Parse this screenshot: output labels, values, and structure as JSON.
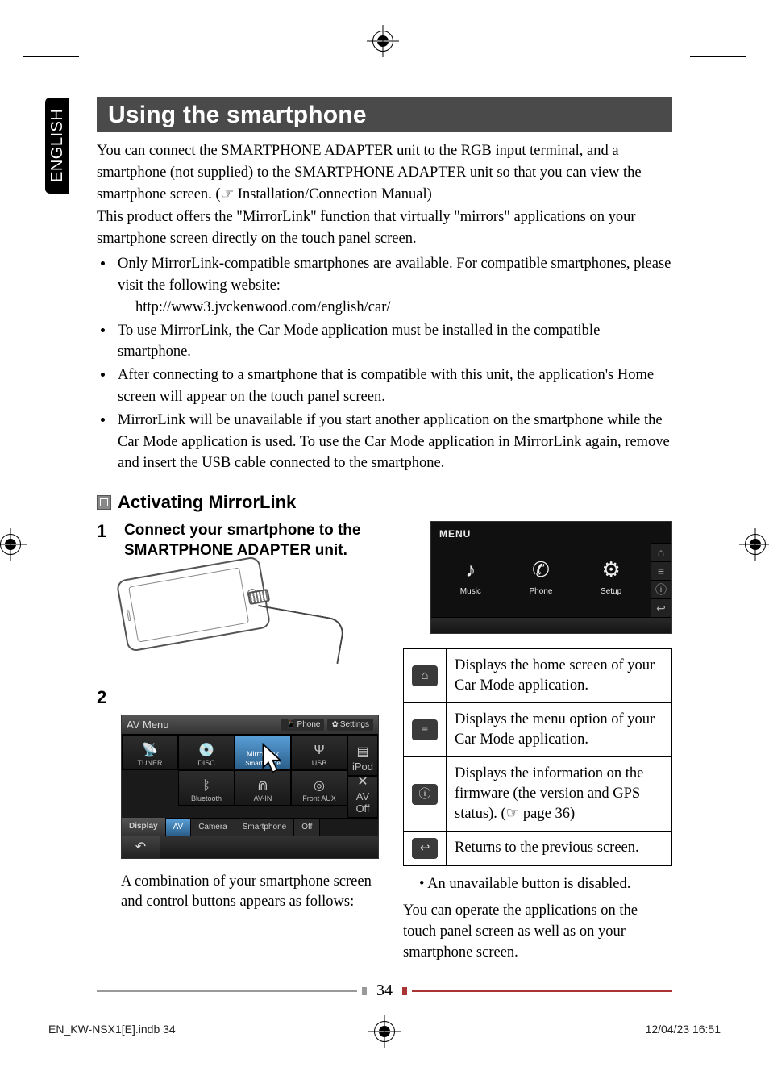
{
  "tab_label": "ENGLISH",
  "title": "Using the smartphone",
  "intro": {
    "p1": "You can connect the SMARTPHONE ADAPTER unit to the RGB input terminal, and a smartphone (not supplied) to the SMARTPHONE ADAPTER unit so that you can view the smartphone screen. (☞ Installation/Connection Manual)",
    "p2": "This product offers the \"MirrorLink\" function that virtually \"mirrors\" applications on your smartphone screen directly on the touch panel screen."
  },
  "bullets": {
    "b1a": "Only MirrorLink-compatible smartphones are available. For compatible smartphones, please visit the following website:",
    "b1b": "http://www3.jvckenwood.com/english/car/",
    "b2": "To use MirrorLink, the Car Mode application must be installed in the compatible smartphone.",
    "b3": "After connecting to a smartphone that is compatible with this unit, the application's Home screen will appear on the touch panel screen.",
    "b4": "MirrorLink will be unavailable if you start another application on the smartphone while the Car Mode application is used. To use the Car Mode application in MirrorLink again, remove and insert the USB cable connected to the smartphone."
  },
  "subheading": "Activating MirrorLink",
  "step1_num": "1",
  "step1_txt": "Connect your smartphone to the SMARTPHONE ADAPTER unit.",
  "step2_num": "2",
  "av_menu": {
    "title": "AV Menu",
    "hdr_phone": "Phone",
    "hdr_settings": "Settings",
    "cells": {
      "tuner": "TUNER",
      "disc": "DISC",
      "mirrorlink": "MirrorLink",
      "smartphone_sub": "Smartphone",
      "usb": "USB",
      "ipod": "iPod",
      "bt": "Bluetooth",
      "avin": "AV-IN",
      "frontaux": "Front AUX",
      "avoff": "AV Off"
    },
    "tabs": {
      "display": "Display",
      "av": "AV",
      "camera": "Camera",
      "smartphone": "Smartphone",
      "off": "Off"
    }
  },
  "caption": "A combination of your smartphone screen and control buttons appears as follows:",
  "menu_screen": {
    "title": "MENU",
    "music": "Music",
    "phone": "Phone",
    "setup": "Setup"
  },
  "icon_table": {
    "r1": "Displays the home screen of your Car Mode application.",
    "r2": "Displays the menu option of your Car Mode application.",
    "r3": "Displays the information on the firmware (the version and GPS status). (☞ page 36)",
    "r4": "Returns to the previous screen."
  },
  "note": "•   An unavailable button is disabled.",
  "para2": "You can operate the applications on the touch panel screen as well as on your smartphone screen.",
  "page_number": "34",
  "footer_left": "EN_KW-NSX1[E].indb   34",
  "footer_right": "12/04/23   16:51"
}
